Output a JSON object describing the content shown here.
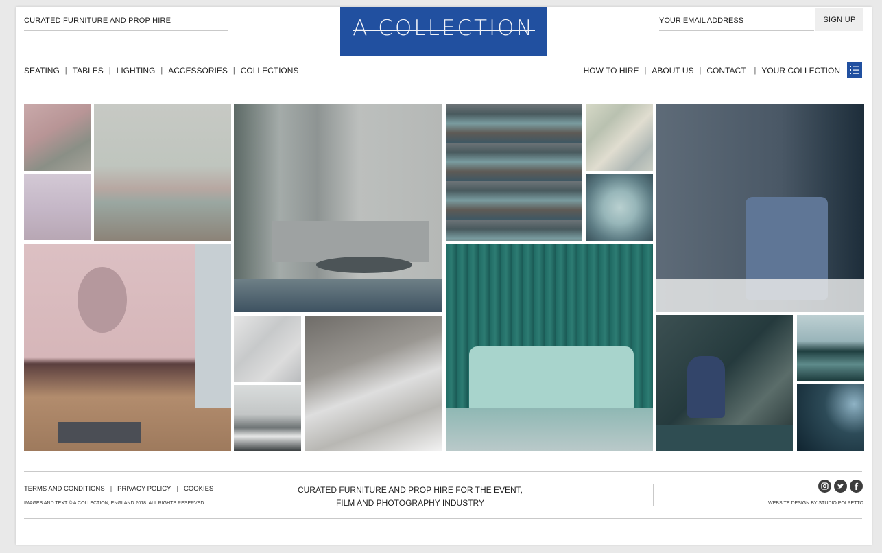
{
  "header": {
    "tagline": "CURATED FURNITURE AND PROP HIRE",
    "logo_text": "A COLLECTION",
    "email_placeholder": "YOUR EMAIL ADDRESS",
    "signup_label": "SIGN UP"
  },
  "nav": {
    "left": [
      "SEATING",
      "TABLES",
      "LIGHTING",
      "ACCESSORIES",
      "COLLECTIONS"
    ],
    "right": [
      "HOW TO HIRE",
      "ABOUT US",
      "CONTACT",
      "YOUR COLLECTION"
    ],
    "menu_icon": "list-icon"
  },
  "footer": {
    "links": [
      "TERMS AND CONDITIONS",
      "PRIVACY POLICY",
      "COOKIES"
    ],
    "copyright": "IMAGES AND TEXT © A COLLECTION, ENGLAND 2018. ALL RIGHTS RESERVED",
    "center_line1": "CURATED FURNITURE AND PROP HIRE FOR THE EVENT,",
    "center_line2": "FILM AND PHOTOGRAPHY INDUSTRY",
    "social_icons": [
      "instagram-icon",
      "twitter-icon",
      "facebook-icon"
    ],
    "credit": "WEBSITE DESIGN BY STUDIO POLPETTO"
  },
  "colors": {
    "brand_blue": "#2150a0",
    "rule": "#c9c9c9"
  }
}
